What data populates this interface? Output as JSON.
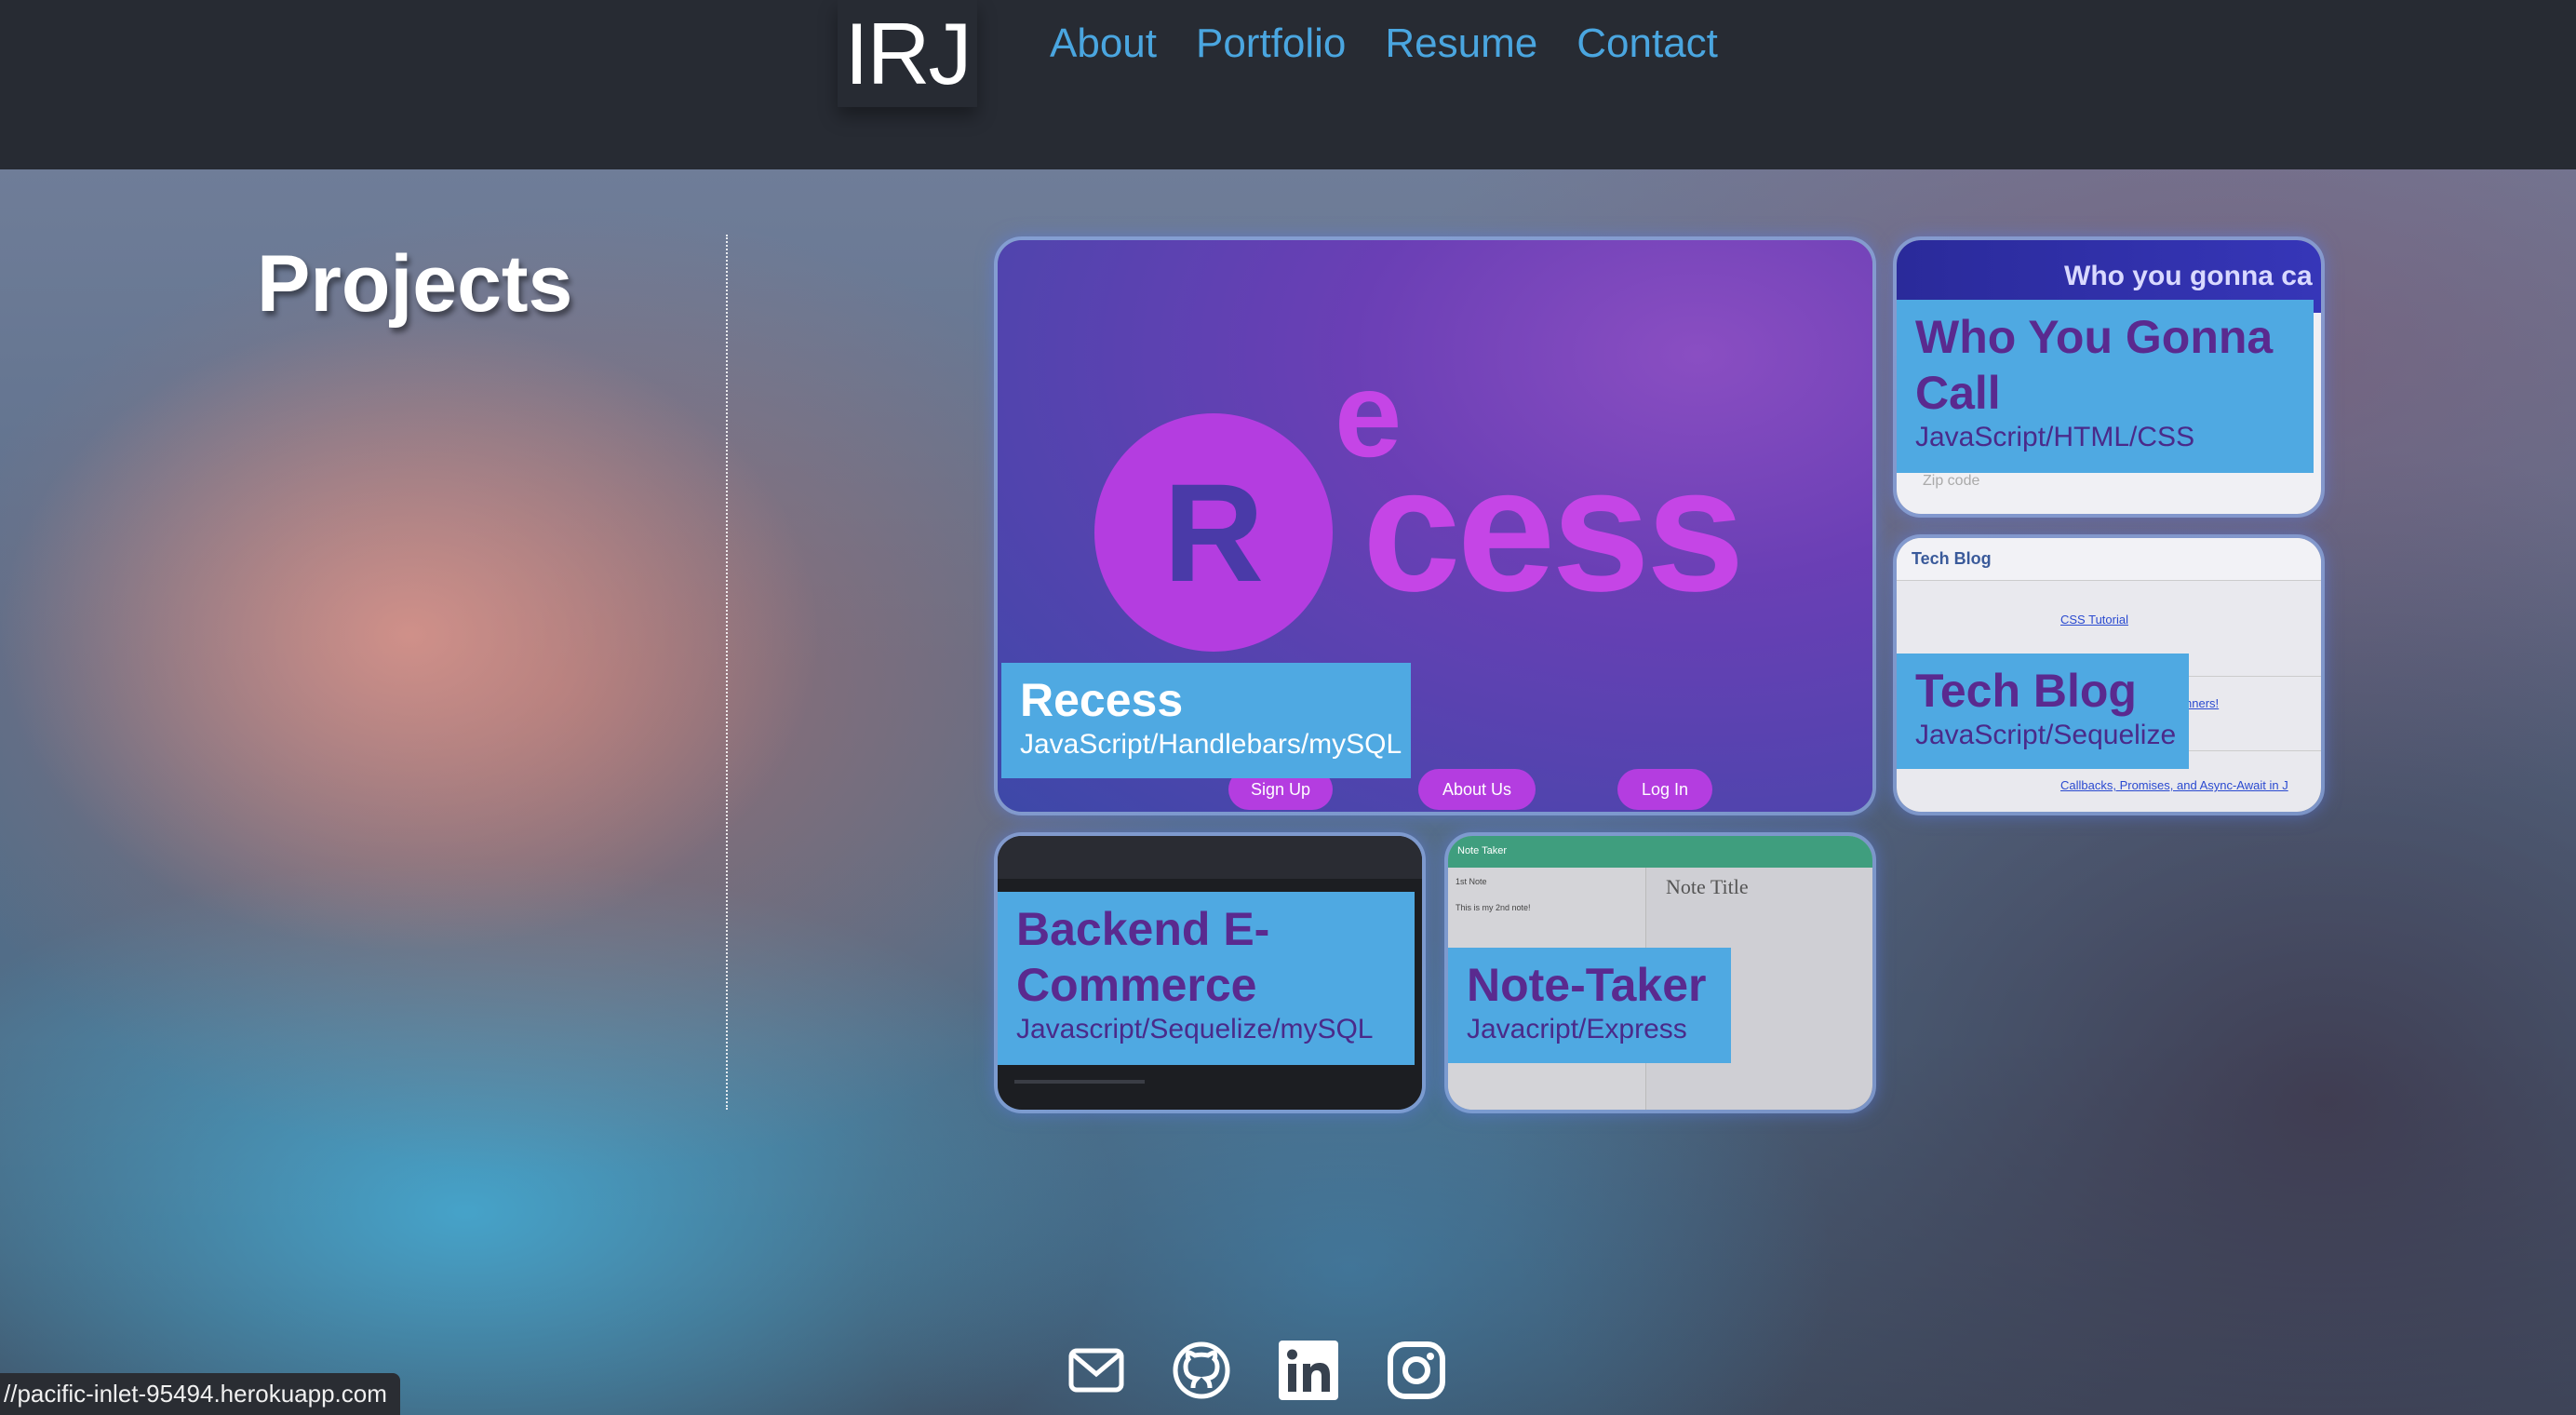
{
  "header": {
    "logo": "IRJ",
    "nav": [
      "About",
      "Portfolio",
      "Resume",
      "Contact"
    ]
  },
  "main": {
    "title": "Projects",
    "projects": [
      {
        "name": "Recess",
        "tech": "JavaScript/Handlebars/mySQL",
        "screenshot": {
          "letter": "R",
          "e": "e",
          "cess": "cess",
          "buttons": [
            "Sign Up",
            "About Us",
            "Log In"
          ]
        }
      },
      {
        "name": "Who You Gonna Call",
        "tech": "JavaScript/HTML/CSS",
        "screenshot": {
          "banner": "Who you gonna ca",
          "zip": "Zip code"
        }
      },
      {
        "name": "Tech Blog",
        "tech": "JavaScript/Sequelize",
        "screenshot": {
          "header": "Tech Blog",
          "links": [
            "CSS Tutorial",
            "nners!",
            "Callbacks, Promises, and Async-Await in J"
          ]
        }
      },
      {
        "name": "Backend E-Commerce",
        "tech": "Javascript/Sequelize/mySQL"
      },
      {
        "name": "Note-Taker",
        "tech": "Javacript/Express",
        "screenshot": {
          "bar": "Note Taker",
          "title": "Note Title",
          "notes": [
            "1st Note",
            "This is my 2nd note!"
          ]
        }
      }
    ]
  },
  "footer": {
    "icons": [
      "mail-icon",
      "github-icon",
      "linkedin-icon",
      "instagram-icon"
    ]
  },
  "status_bar": {
    "url": "//pacific-inlet-95494.herokuapp.com"
  }
}
